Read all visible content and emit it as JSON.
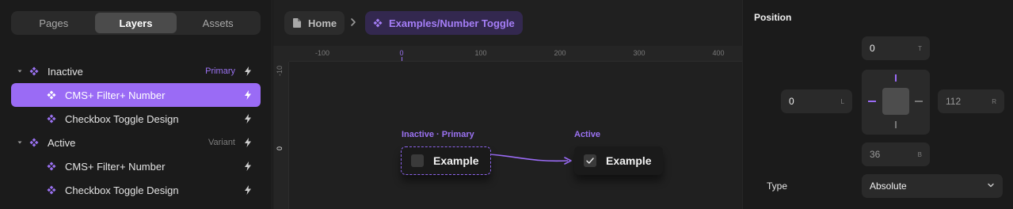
{
  "left_panel": {
    "tabs": [
      {
        "label": "Pages",
        "active": false
      },
      {
        "label": "Layers",
        "active": true
      },
      {
        "label": "Assets",
        "active": false
      }
    ],
    "layers": [
      {
        "label": "Inactive",
        "tag": "Primary",
        "tag_style": "primary",
        "level": 0,
        "expanded": true,
        "selected": false
      },
      {
        "label": "CMS+ Filter+ Number",
        "tag": "",
        "level": 1,
        "selected": true
      },
      {
        "label": "Checkbox Toggle Design",
        "tag": "",
        "level": 1,
        "selected": false
      },
      {
        "label": "Active",
        "tag": "Variant",
        "tag_style": "variant",
        "level": 0,
        "expanded": true,
        "selected": false
      },
      {
        "label": "CMS+ Filter+ Number",
        "tag": "",
        "level": 1,
        "selected": false
      },
      {
        "label": "Checkbox Toggle Design",
        "tag": "",
        "level": 1,
        "selected": false
      }
    ]
  },
  "canvas": {
    "breadcrumb": {
      "home": "Home",
      "current": "Examples/Number Toggle"
    },
    "ruler_h": [
      "-100",
      "0",
      "100",
      "200",
      "300",
      "400"
    ],
    "ruler_v": [
      "-10",
      "0"
    ],
    "frames": {
      "inactive_label": "Inactive · Primary",
      "active_label": "Active",
      "inactive_text": "Example",
      "active_text": "Example"
    }
  },
  "properties": {
    "title": "Position",
    "top": {
      "value": "0",
      "side": "T"
    },
    "left": {
      "value": "0",
      "side": "L"
    },
    "right": {
      "value": "112",
      "side": "R"
    },
    "bottom": {
      "value": "36",
      "side": "B"
    },
    "type_label": "Type",
    "type_value": "Absolute"
  },
  "colors": {
    "accent": "#9a6bf5",
    "accent_text": "#a57ef7",
    "breadcrumb_bg": "#33284f"
  }
}
